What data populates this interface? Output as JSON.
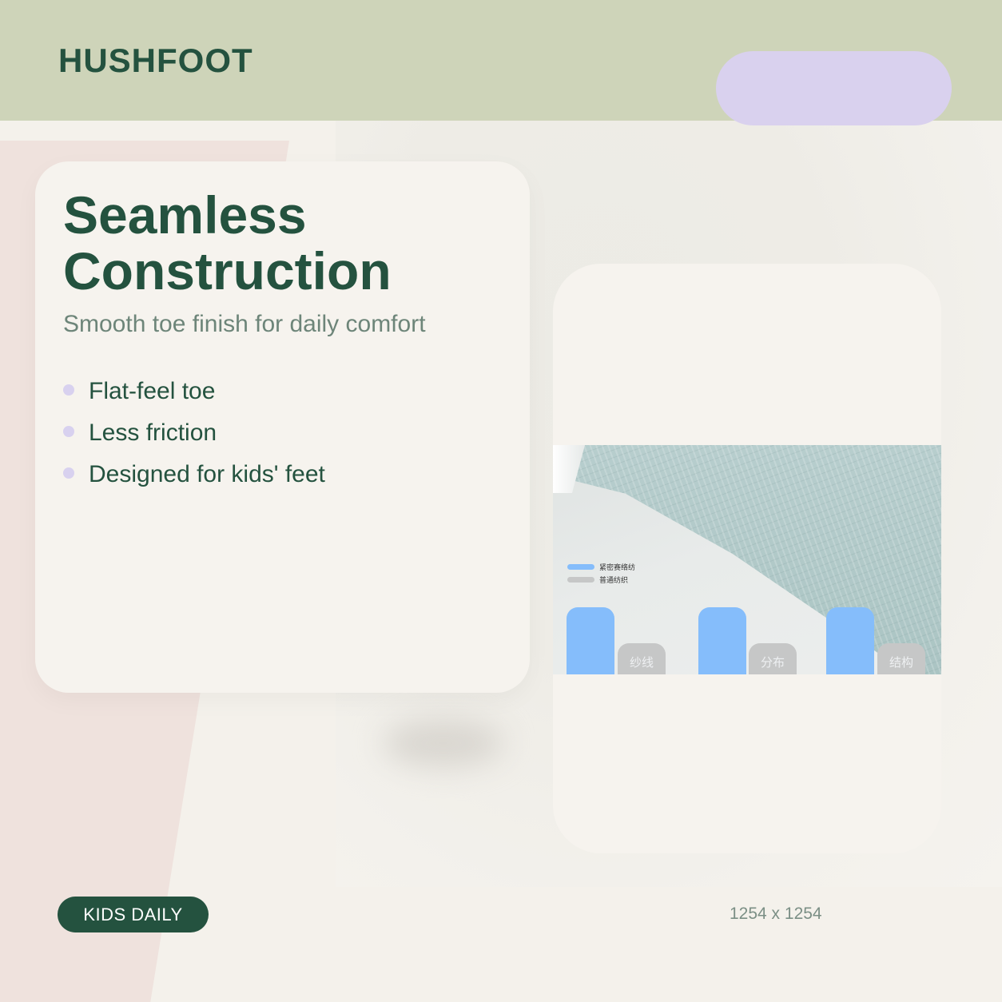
{
  "brand": {
    "name": "HUSHFOOT"
  },
  "colors": {
    "brand_green": "#24523f",
    "header_bg": "#ced4b9",
    "accent_lavender": "#d9d1ee",
    "pink_panel": "#efe2dd",
    "chart_blue": "#85bdfb",
    "chart_gray": "#c6c7c7"
  },
  "card": {
    "title_line1": "Seamless",
    "title_line2": "Construction",
    "subtitle": "Smooth toe finish for daily comfort",
    "features": [
      {
        "label": "Flat-feel toe"
      },
      {
        "label": "Less friction"
      },
      {
        "label": "Designed for kids' feet"
      }
    ]
  },
  "product_image": {
    "legend": [
      {
        "label": "紧密赛络纺",
        "color": "#85bdfb"
      },
      {
        "label": "普通纺织",
        "color": "#c6c7c7"
      }
    ],
    "bar_labels": [
      "纱线",
      "分布",
      "结构"
    ]
  },
  "footer": {
    "tag": "KIDS DAILY",
    "dimensions": "1254 x 1254"
  }
}
